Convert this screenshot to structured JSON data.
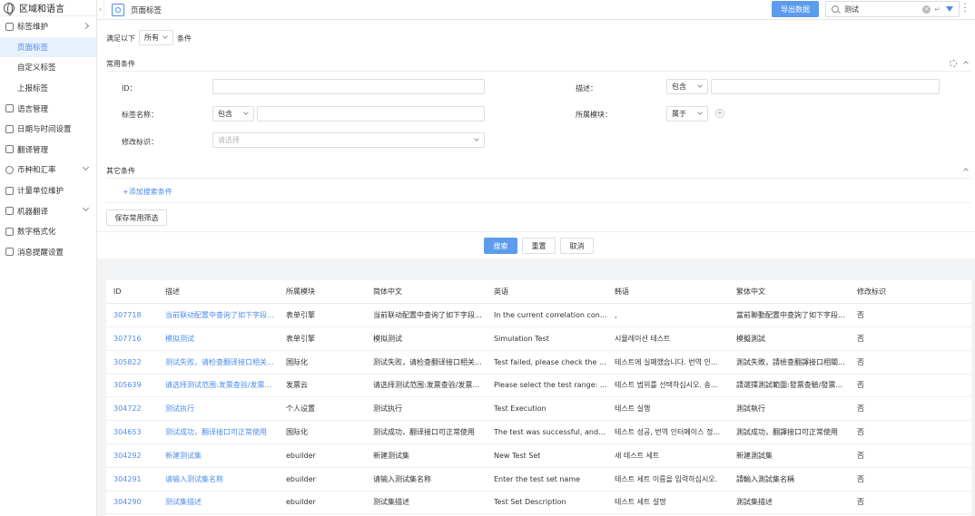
{
  "sidebar": {
    "title": "区域和语言",
    "items": [
      {
        "label": "标签维护",
        "icon": "tag-icon",
        "chevron": "right"
      },
      {
        "label": "页面标签",
        "sub": true,
        "active": true
      },
      {
        "label": "自定义标签",
        "sub": true
      },
      {
        "label": "上报标签",
        "sub": true
      },
      {
        "label": "语言管理",
        "icon": "language-icon"
      },
      {
        "label": "日期与时间设置",
        "icon": "calendar-icon"
      },
      {
        "label": "翻译管理",
        "icon": "translate-icon"
      },
      {
        "label": "币种和汇率",
        "icon": "currency-icon",
        "chevron": "down"
      },
      {
        "label": "计量单位维护",
        "icon": "unit-icon"
      },
      {
        "label": "机器翻译",
        "icon": "machine-translate-icon",
        "chevron": "down"
      },
      {
        "label": "数字格式化",
        "icon": "number-format-icon"
      },
      {
        "label": "消息提醒设置",
        "icon": "message-icon"
      }
    ]
  },
  "topbar": {
    "page_title": "页面标签",
    "export_label": "导出数据",
    "search_value": "测试"
  },
  "filter": {
    "match_prefix": "满足以下",
    "match_select": "所有",
    "match_suffix": "条件",
    "common_title": "常用条件",
    "id_label": "ID：",
    "desc_label": "描述：",
    "desc_op": "包含",
    "name_label": "标签名称：",
    "name_op": "包含",
    "module_label": "所属模块：",
    "module_op": "属于",
    "flag_label": "修改标识：",
    "flag_placeholder": "请选择",
    "other_title": "其它条件",
    "add_condition": "+添加搜索条件",
    "save_label": "保存常用筛选",
    "search_label": "搜索",
    "reset_label": "重置",
    "cancel_label": "取消"
  },
  "table": {
    "columns": [
      "ID",
      "描述",
      "所属模块",
      "简体中文",
      "英语",
      "韩语",
      "繁体中文",
      "修改标识"
    ],
    "rows": [
      [
        "307718",
        "当前联动配置中查询了如下字段...",
        "表单引擎",
        "当前联动配置中查询了如下字段...",
        "In the current correlation configu...",
        ",",
        "當前聯動配置中查詢了如下字段...",
        "否"
      ],
      [
        "307716",
        "模拟测试",
        "表单引擎",
        "模拟测试",
        "Simulation Test",
        "시뮬레이션 테스트",
        "模擬測試",
        "否"
      ],
      [
        "305822",
        "测试失败，请检查翻译接口相关...",
        "国际化",
        "测试失败，请检查翻译接口相关...",
        "Test failed, please check the con...",
        "테스트에 실패했습니다. 번역 인...",
        "測試失敗，請檢查翻譯接口相關...",
        "否"
      ],
      [
        "305639",
        "请选择测试范围:发票查验/发票...",
        "发票云",
        "请选择测试范围:发票查验/发票...",
        "Please select the test range: inv...",
        "테스트 범위를 선택하십시오. 송...",
        "請選擇測試範圍:發票查驗/發票...",
        "否"
      ],
      [
        "304722",
        "测试执行",
        "个人设置",
        "测试执行",
        "Test Execution",
        "테스트 실행",
        "測試執行",
        "否"
      ],
      [
        "304653",
        "测试成功，翻译接口可正常使用",
        "国际化",
        "测试成功，翻译接口可正常使用",
        "The test was successful, and th...",
        "테스트 성공, 번역 인터페이스 정...",
        "測試成功，翻譯接口可正常使用",
        "否"
      ],
      [
        "304292",
        "新建测试集",
        "ebuilder",
        "新建测试集",
        "New Test Set",
        "새 테스트 세트",
        "新建測試集",
        "否"
      ],
      [
        "304291",
        "请输入测试集名称",
        "ebuilder",
        "请输入测试集名称",
        "Enter the test set name",
        "테스트 세트 이름을 입력하십시오.",
        "請輸入測試集名稱",
        "否"
      ],
      [
        "304290",
        "测试集描述",
        "ebuilder",
        "测试集描述",
        "Test Set Description",
        "테스트 세트 설명",
        "測試集描述",
        "否"
      ]
    ]
  }
}
